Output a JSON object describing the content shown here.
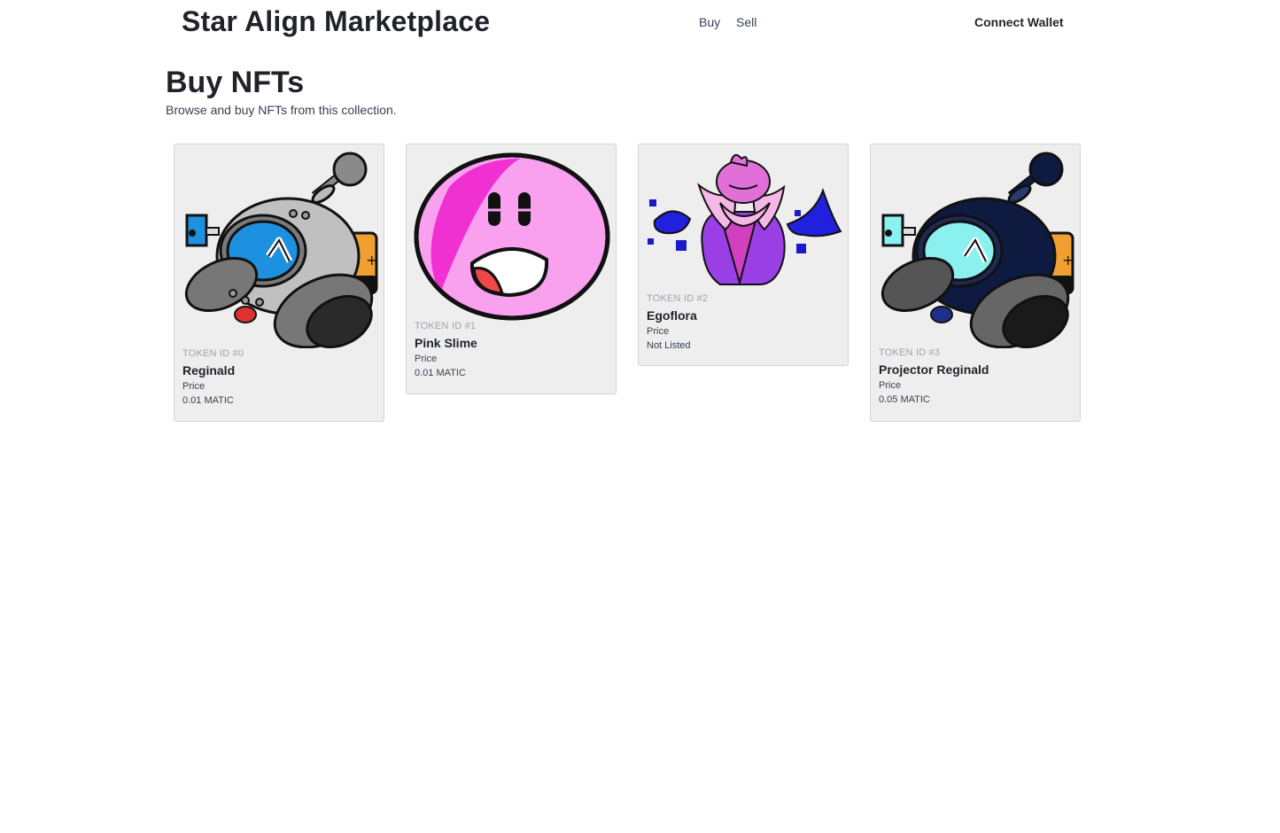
{
  "header": {
    "brand": "Star Align Marketplace",
    "nav": [
      "Buy",
      "Sell"
    ],
    "connect_label": "Connect Wallet"
  },
  "main": {
    "title": "Buy NFTs",
    "subtitle": "Browse and buy NFTs from this collection."
  },
  "cards": [
    {
      "token_id": "TOKEN ID #0",
      "name": "Reginald",
      "price_label": "Price",
      "price": "0.01 MATIC",
      "image": "robot-gray"
    },
    {
      "token_id": "TOKEN ID #1",
      "name": "Pink Slime",
      "price_label": "Price",
      "price": "0.01 MATIC",
      "image": "pink-slime"
    },
    {
      "token_id": "TOKEN ID #2",
      "name": "Egoflora",
      "price_label": "Price",
      "price": "Not Listed",
      "image": "egoflora"
    },
    {
      "token_id": "TOKEN ID #3",
      "name": "Projector Reginald",
      "price_label": "Price",
      "price": "0.05 MATIC",
      "image": "robot-navy"
    }
  ],
  "colors": {
    "card_bg": "#eeeeee",
    "text_dark": "#1f2329",
    "token_gray": "#9ca3af"
  }
}
